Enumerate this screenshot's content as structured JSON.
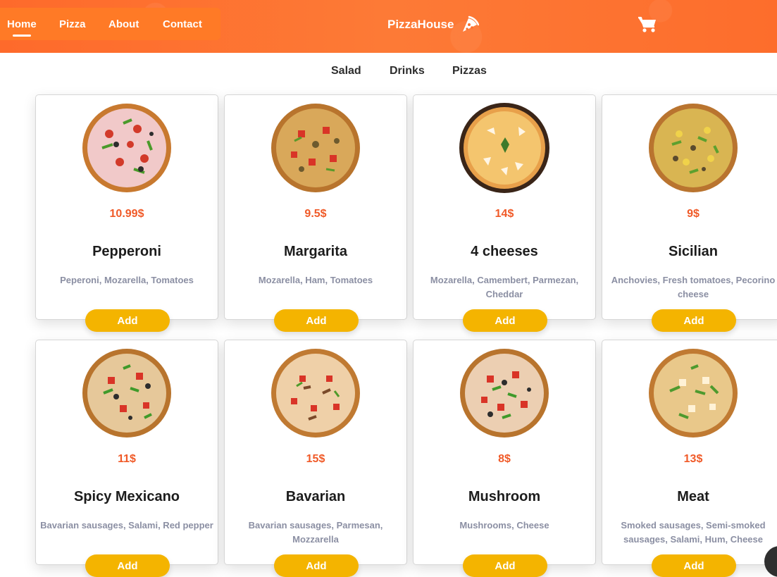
{
  "header": {
    "nav": [
      {
        "label": "Home",
        "active": true
      },
      {
        "label": "Pizza"
      },
      {
        "label": "About"
      },
      {
        "label": "Contact"
      }
    ],
    "brand": "PizzaHouse",
    "brand_icon": "pizza-slice-icon",
    "cart_icon": "cart-icon",
    "accent_color": "#fd6e2d"
  },
  "categories": [
    "Salad",
    "Drinks",
    "Pizzas"
  ],
  "add_label": "Add",
  "colors": {
    "price": "#f05a28",
    "button": "#f4b400",
    "description": "#8b8fa3"
  },
  "products": [
    {
      "price": "10.99$",
      "name": "Pepperoni",
      "description": "Peperoni, Mozarella, Tomatoes"
    },
    {
      "price": "9.5$",
      "name": "Margarita",
      "description": "Mozarella, Ham, Tomatoes"
    },
    {
      "price": "14$",
      "name": "4 cheeses",
      "description": "Mozarella, Camembert, Parmezan, Cheddar"
    },
    {
      "price": "9$",
      "name": "Sicilian",
      "description": "Anchovies, Fresh tomatoes, Pecorino cheese"
    },
    {
      "price": "11$",
      "name": "Spicy Mexicano",
      "description": "Bavarian sausages, Salami, Red pepper"
    },
    {
      "price": "15$",
      "name": "Bavarian",
      "description": "Bavarian sausages, Parmesan, Mozzarella"
    },
    {
      "price": "8$",
      "name": "Mushroom",
      "description": "Mushrooms, Cheese"
    },
    {
      "price": "13$",
      "name": "Meat",
      "description": "Smoked sausages, Semi-smoked sausages, Salami, Hum, Cheese"
    }
  ]
}
